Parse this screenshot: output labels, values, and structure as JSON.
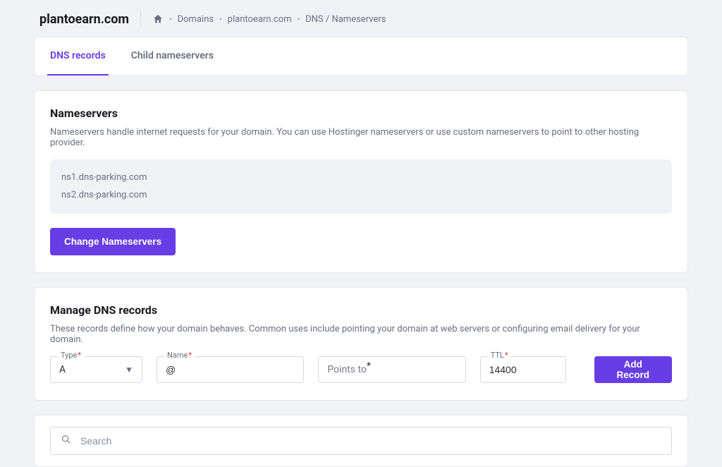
{
  "header": {
    "domain": "plantoearn.com",
    "crumbSep": "-",
    "crumbs": [
      "Domains",
      "plantoearn.com",
      "DNS / Nameservers"
    ]
  },
  "tabs": {
    "dns_records": "DNS records",
    "child_nameservers": "Child nameservers"
  },
  "nameservers": {
    "title": "Nameservers",
    "desc": "Nameservers handle internet requests for your domain. You can use Hostinger nameservers or use custom nameservers to point to other hosting provider.",
    "ns1": "ns1.dns-parking.com",
    "ns2": "ns2.dns-parking.com",
    "change_btn": "Change Nameservers"
  },
  "manage": {
    "title": "Manage DNS records",
    "desc": "These records define how your domain behaves. Common uses include pointing your domain at web servers or configuring email delivery for your domain.",
    "type_label": "Type",
    "type_value": "A",
    "name_label": "Name",
    "name_value": "@",
    "points_label": "Points to",
    "ttl_label": "TTL",
    "ttl_value": "14400",
    "add_btn": "Add Record"
  },
  "search": {
    "placeholder": "Search"
  },
  "req_star": "*"
}
